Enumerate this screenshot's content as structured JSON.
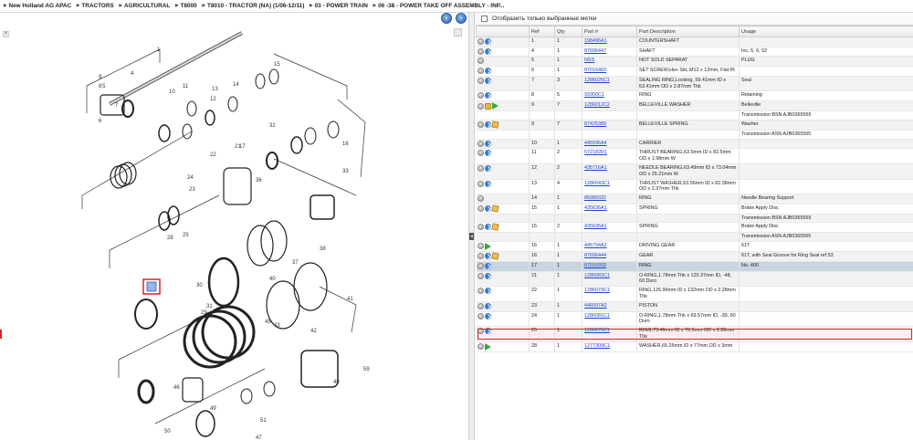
{
  "breadcrumb": [
    "New Holland AG APAC",
    "TRACTORS",
    "AGRICULTURAL",
    "T8000",
    "T8010 - TRACTOR (NA) (1/06-12/11)",
    "03 - POWER TRAIN",
    "06 -38 - POWER TAKE OFF ASSEMBLY - INP..."
  ],
  "nav": {
    "prev_icon": "arrow-left-icon",
    "next_icon": "arrow-right-icon"
  },
  "filter": {
    "label": "Отобразить только выбранные метки",
    "checked": false
  },
  "table": {
    "columns": [
      "",
      "Ref",
      "Qty",
      "Part #",
      "Part Description",
      "Usage"
    ],
    "rows": [
      {
        "icons": [
          "info",
          "arrow"
        ],
        "ref": "1",
        "qty": "1",
        "part": "198496A1",
        "desc": "COUNTERSHAFT",
        "usage": ""
      },
      {
        "icons": [
          "info",
          "arrow"
        ],
        "ref": "4",
        "qty": "1",
        "part": "87696447",
        "desc": "SHAFT",
        "usage": "Inc. 5, 6, 52"
      },
      {
        "icons": [
          "info"
        ],
        "ref": "5",
        "qty": "1",
        "part": "NSS",
        "desc": "NOT SOLD SEPARAT",
        "usage": "PLUG"
      },
      {
        "icons": [
          "info",
          "arrow"
        ],
        "ref": "6",
        "qty": "1",
        "part": "87016483",
        "desc": "SET SCREW,Hex Skt, M12 x 12mm, Flat Pt",
        "usage": ""
      },
      {
        "icons": [
          "info",
          "arrow"
        ],
        "ref": "7",
        "qty": "3",
        "part": "1286026C1",
        "desc": "SEALING RING,Locking, 59.41mm ID x 63.41mm OD x 2.87mm Thk",
        "usage": "Seal"
      },
      {
        "icons": [
          "info",
          "arrow"
        ],
        "ref": "8",
        "qty": "5",
        "part": "93350C1",
        "desc": "RING",
        "usage": "Retaining"
      },
      {
        "icons": [
          "info",
          "note",
          "go"
        ],
        "ref": "9",
        "qty": "7",
        "part": "1286012C2",
        "desc": "BELLEVILLE WASHER",
        "usage": "Belleville"
      },
      {
        "icons": [],
        "ref": "",
        "qty": "",
        "part": "",
        "desc": "",
        "usage": "Transmission BSN AJB0365565"
      },
      {
        "icons": [
          "info",
          "arrow",
          "box"
        ],
        "ref": "9",
        "qty": "7",
        "part": "87425389",
        "desc": "BELLEVILLE SPRING",
        "usage": "Washer"
      },
      {
        "icons": [],
        "ref": "",
        "qty": "",
        "part": "",
        "desc": "",
        "usage": "Transmission ASN AJB0365565"
      },
      {
        "icons": [
          "info",
          "arrow"
        ],
        "ref": "10",
        "qty": "1",
        "part": "445596A4",
        "desc": "CARRIER",
        "usage": ""
      },
      {
        "icons": [
          "info",
          "arrow"
        ],
        "ref": "11",
        "qty": "2",
        "part": "572182R1",
        "desc": "THRUST BEARING,63.5mm ID x 82.5mm OD x 1.98mm W",
        "usage": ""
      },
      {
        "icons": [
          "info",
          "arrow"
        ],
        "ref": "12",
        "qty": "2",
        "part": "435716A1",
        "desc": "NEEDLE BEARING,63.49mm ID x 73.04mm OD x 25.21mm W",
        "usage": ""
      },
      {
        "icons": [
          "info",
          "arrow"
        ],
        "ref": "13",
        "qty": "4",
        "part": "1286043C1",
        "desc": "THRUST WASHER,63.56mm ID x 82.38mm OD x 2.37mm Thk",
        "usage": ""
      },
      {
        "icons": [
          "info"
        ],
        "ref": "14",
        "qty": "1",
        "part": "86989332",
        "desc": "RING",
        "usage": "Needle Bearing Support"
      },
      {
        "icons": [
          "info",
          "arrow",
          "box"
        ],
        "ref": "15",
        "qty": "1",
        "part": "435636A1",
        "desc": "SPRING",
        "usage": "Brake Apply Disc"
      },
      {
        "icons": [],
        "ref": "",
        "qty": "",
        "part": "",
        "desc": "",
        "usage": "Transmission BSN AJB0365565"
      },
      {
        "icons": [
          "info",
          "arrow",
          "box"
        ],
        "ref": "15",
        "qty": "2",
        "part": "435636A1",
        "desc": "SPRING",
        "usage": "Brake Apply Disc"
      },
      {
        "icons": [],
        "ref": "",
        "qty": "",
        "part": "",
        "desc": "",
        "usage": "Transmission ASN AJB0365565"
      },
      {
        "icons": [
          "info",
          "go"
        ],
        "ref": "16",
        "qty": "1",
        "part": "445794A2",
        "desc": "DRIVING GEAR",
        "usage": "61T"
      },
      {
        "icons": [
          "info",
          "arrow",
          "box"
        ],
        "ref": "16",
        "qty": "1",
        "part": "87696444",
        "desc": "GEAR",
        "usage": "61T, with Seal Groove for Ring Seal ref 53"
      },
      {
        "icons": [
          "info",
          "arrow"
        ],
        "ref": "17",
        "qty": "1",
        "part": "87016932",
        "desc": "RING",
        "usage": "No. 400",
        "selected": true
      },
      {
        "icons": [
          "info",
          "arrow"
        ],
        "ref": "21",
        "qty": "1",
        "part": "1286083C1",
        "desc": "O-RING,1.78mm Thk x 120.37mm ID, -48, 60 Duro",
        "usage": ""
      },
      {
        "icons": [
          "info",
          "arrow"
        ],
        "ref": "22",
        "qty": "1",
        "part": "1286079C1",
        "desc": "RING,126.96mm ID x 132mm OD x 2.28mm Thk",
        "usage": ""
      },
      {
        "icons": [
          "info",
          "arrow"
        ],
        "ref": "23",
        "qty": "1",
        "part": "446597A2",
        "desc": "PISTON",
        "usage": ""
      },
      {
        "icons": [
          "info",
          "arrow"
        ],
        "ref": "24",
        "qty": "1",
        "part": "1286081C1",
        "desc": "O-RING,1.78mm Thk x 69.57mm ID, -39, 60 Duro",
        "usage": ""
      },
      {
        "icons": [
          "info",
          "arrow"
        ],
        "ref": "25",
        "qty": "1",
        "part": "1286076C1",
        "desc": "RING,73.46mm ID x 76.5mm OD x 2.28mm Thk",
        "usage": ""
      },
      {
        "icons": [
          "info",
          "go"
        ],
        "ref": "28",
        "qty": "1",
        "part": "1277309C1",
        "desc": "WASHER,65.25mm ID x 77mm OD x 3mm",
        "usage": ""
      }
    ]
  },
  "diagram": {
    "callouts": [
      "1",
      "4",
      "5",
      "6",
      "7",
      "8",
      "9",
      "10",
      "11",
      "12",
      "13",
      "14",
      "15",
      "16",
      "17",
      "21",
      "22",
      "23",
      "24",
      "25",
      "28",
      "29",
      "30",
      "31",
      "32",
      "33",
      "36",
      "37",
      "38",
      "40",
      "41",
      "42",
      "43",
      "45",
      "46",
      "47",
      "48",
      "49",
      "50",
      "51",
      "59"
    ]
  }
}
